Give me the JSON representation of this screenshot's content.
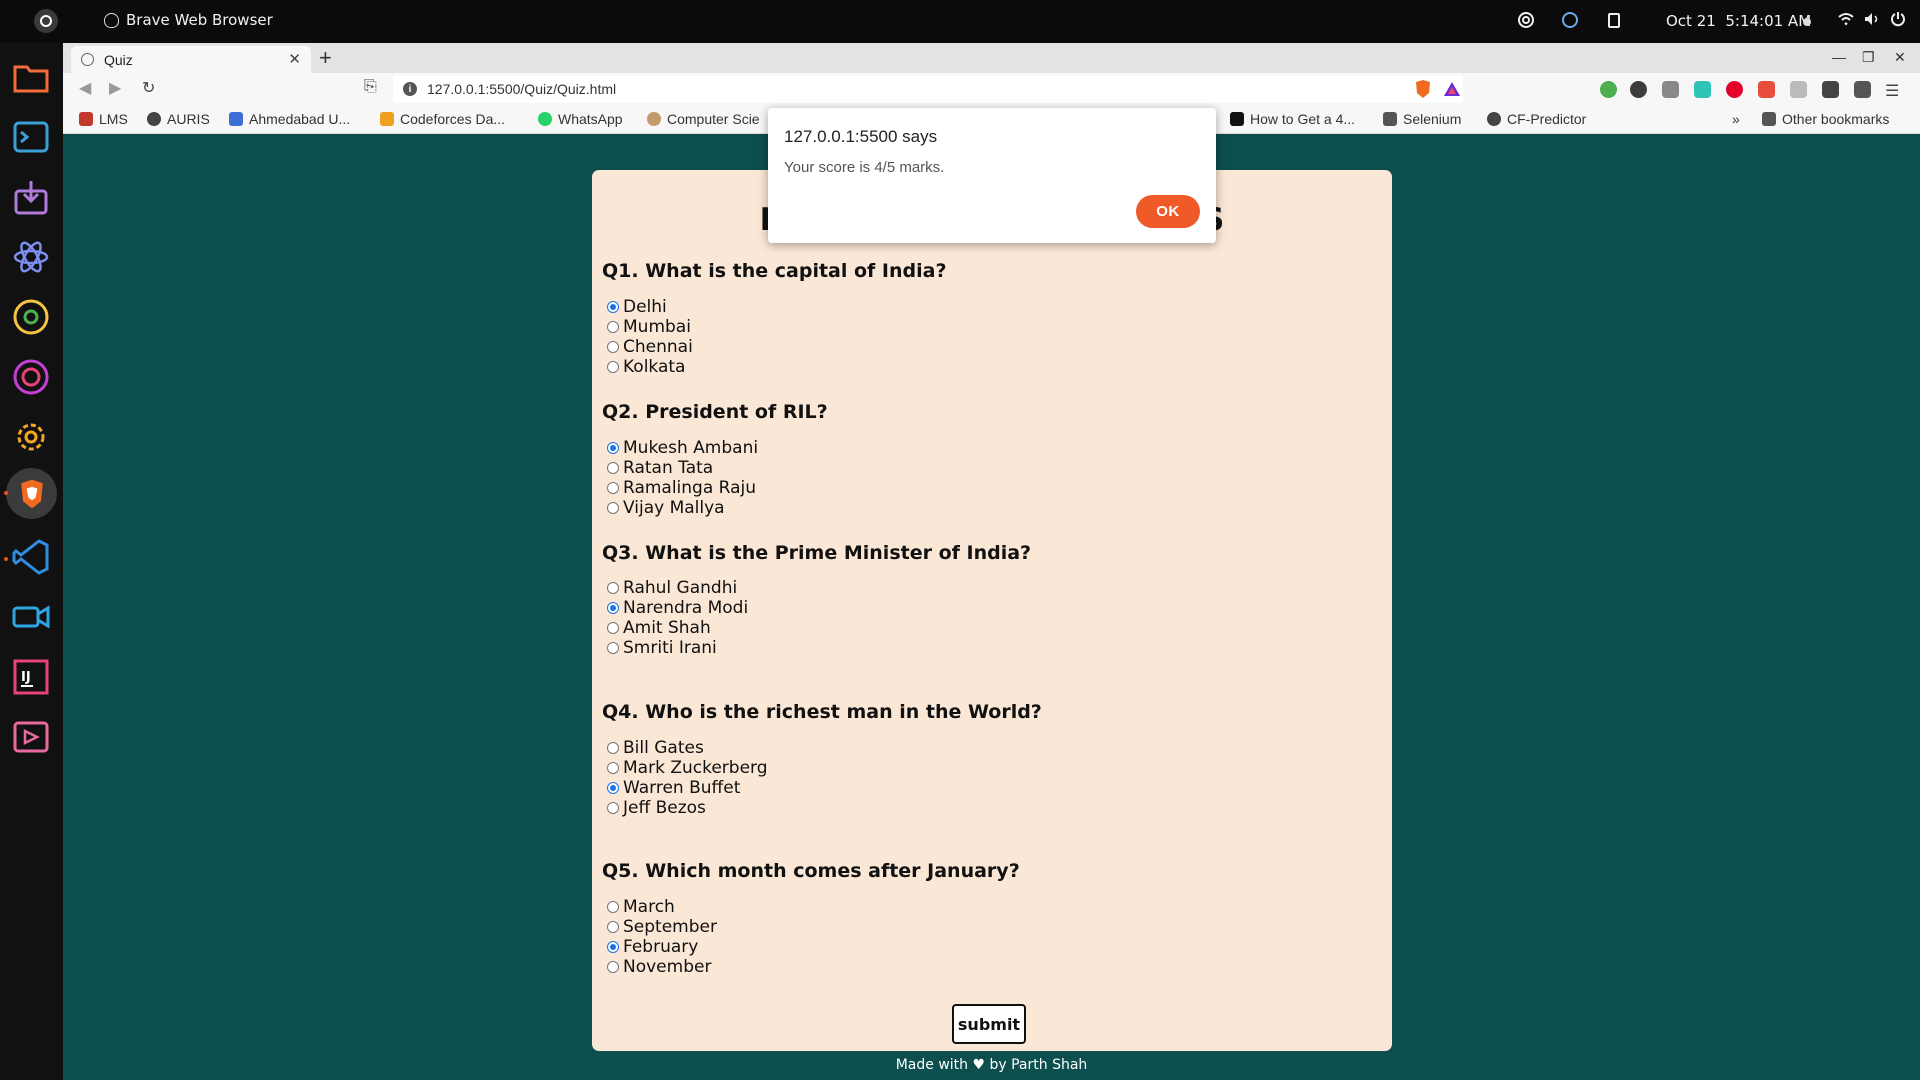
{
  "system": {
    "app_name": "Brave Web Browser",
    "date": "Oct 21",
    "time": "5:14:01 AM"
  },
  "browser": {
    "tab_title": "Quiz",
    "url": "127.0.0.1:5500/Quiz/Quiz.html",
    "bookmarks": [
      "LMS",
      "AURIS",
      "Ahmedabad U...",
      "Codeforces Da...",
      "WhatsApp",
      "Computer Scie",
      "How to Get a 4...",
      "Selenium",
      "CF-Predictor"
    ],
    "other_bookmarks": "Other bookmarks",
    "overflow": "»"
  },
  "quiz": {
    "title_left": "M",
    "title_right": "JS",
    "questions": [
      {
        "text": "Q1. What is the capital of India?",
        "options": [
          "Delhi",
          "Mumbai",
          "Chennai",
          "Kolkata"
        ],
        "selected": 0
      },
      {
        "text": "Q2. President of RIL?",
        "options": [
          "Mukesh Ambani",
          "Ratan Tata",
          "Ramalinga Raju",
          "Vijay Mallya"
        ],
        "selected": 0
      },
      {
        "text": "Q3. What is the Prime Minister of India?",
        "options": [
          "Rahul Gandhi",
          "Narendra Modi",
          "Amit Shah",
          "Smriti Irani"
        ],
        "selected": 1
      },
      {
        "text": "Q4. Who is the richest man in the World?",
        "options": [
          "Bill Gates",
          "Mark Zuckerberg",
          "Warren Buffet",
          "Jeff Bezos"
        ],
        "selected": 2
      },
      {
        "text": "Q5. Which month comes after January?",
        "options": [
          "March",
          "September",
          "February",
          "November"
        ],
        "selected": 2
      }
    ],
    "submit_label": "submit",
    "footer": "Made with ♥ by Parth Shah"
  },
  "alert": {
    "title": "127.0.0.1:5500 says",
    "message": "Your score is 4/5 marks.",
    "ok_label": "OK"
  },
  "colors": {
    "page_bg": "#0d4e4f",
    "card_bg": "#fbe7d6",
    "ok_button": "#f05a28",
    "radio_checked": "#1a73e8"
  }
}
